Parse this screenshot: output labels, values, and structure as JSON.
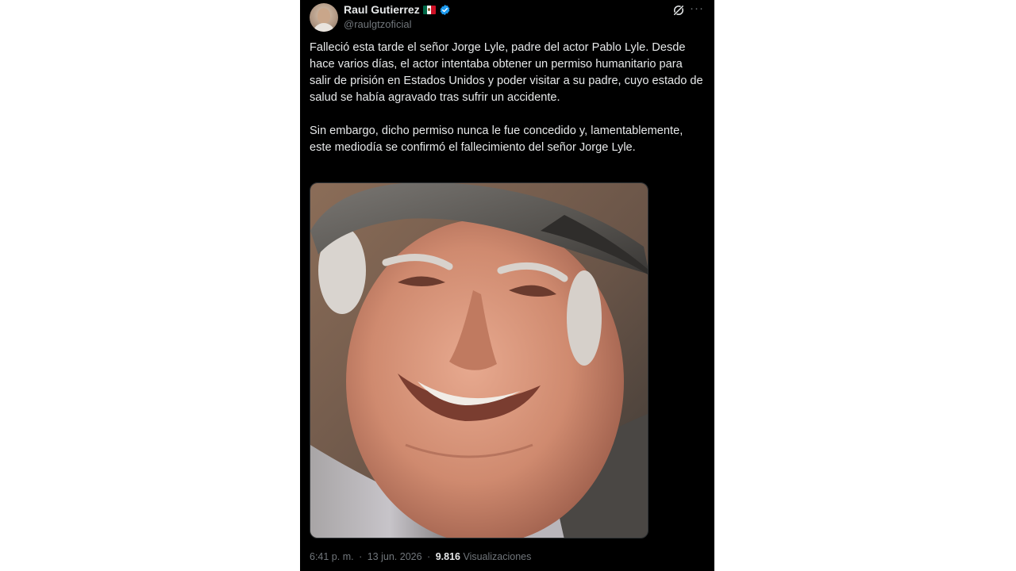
{
  "author": {
    "display_name": "Raul Gutierrez",
    "handle": "@raulgtzoficial",
    "flag_icon": "mexico-flag-icon",
    "verified_icon": "verified-badge-icon",
    "verified_color": "#1d9bf0"
  },
  "tweet": {
    "paragraph_1": "Falleció esta tarde el señor Jorge Lyle, padre del actor Pablo Lyle. Desde hace varios días, el actor intentaba obtener un permiso humanitario para salir de prisión en Estados Unidos y poder visitar a su padre, cuyo estado de salud se había agravado tras sufrir un accidente.",
    "paragraph_2": "Sin embargo, dicho permiso nunca le fue concedido y, lamentablemente, este mediodía se confirmó el fallecimiento del señor Jorge Lyle."
  },
  "media": {
    "type": "photo",
    "subject": "portrait-photo"
  },
  "meta": {
    "time": "6:41 p. m.",
    "date": "13 jun. 2026",
    "views_count": "9.816",
    "views_label": "Visualizaciones",
    "separator": "·"
  },
  "icons": {
    "grok": "grok-icon",
    "more": "more-options-icon"
  },
  "colors": {
    "background": "#000000",
    "text_primary": "#e7e9ea",
    "text_secondary": "#71767b"
  }
}
